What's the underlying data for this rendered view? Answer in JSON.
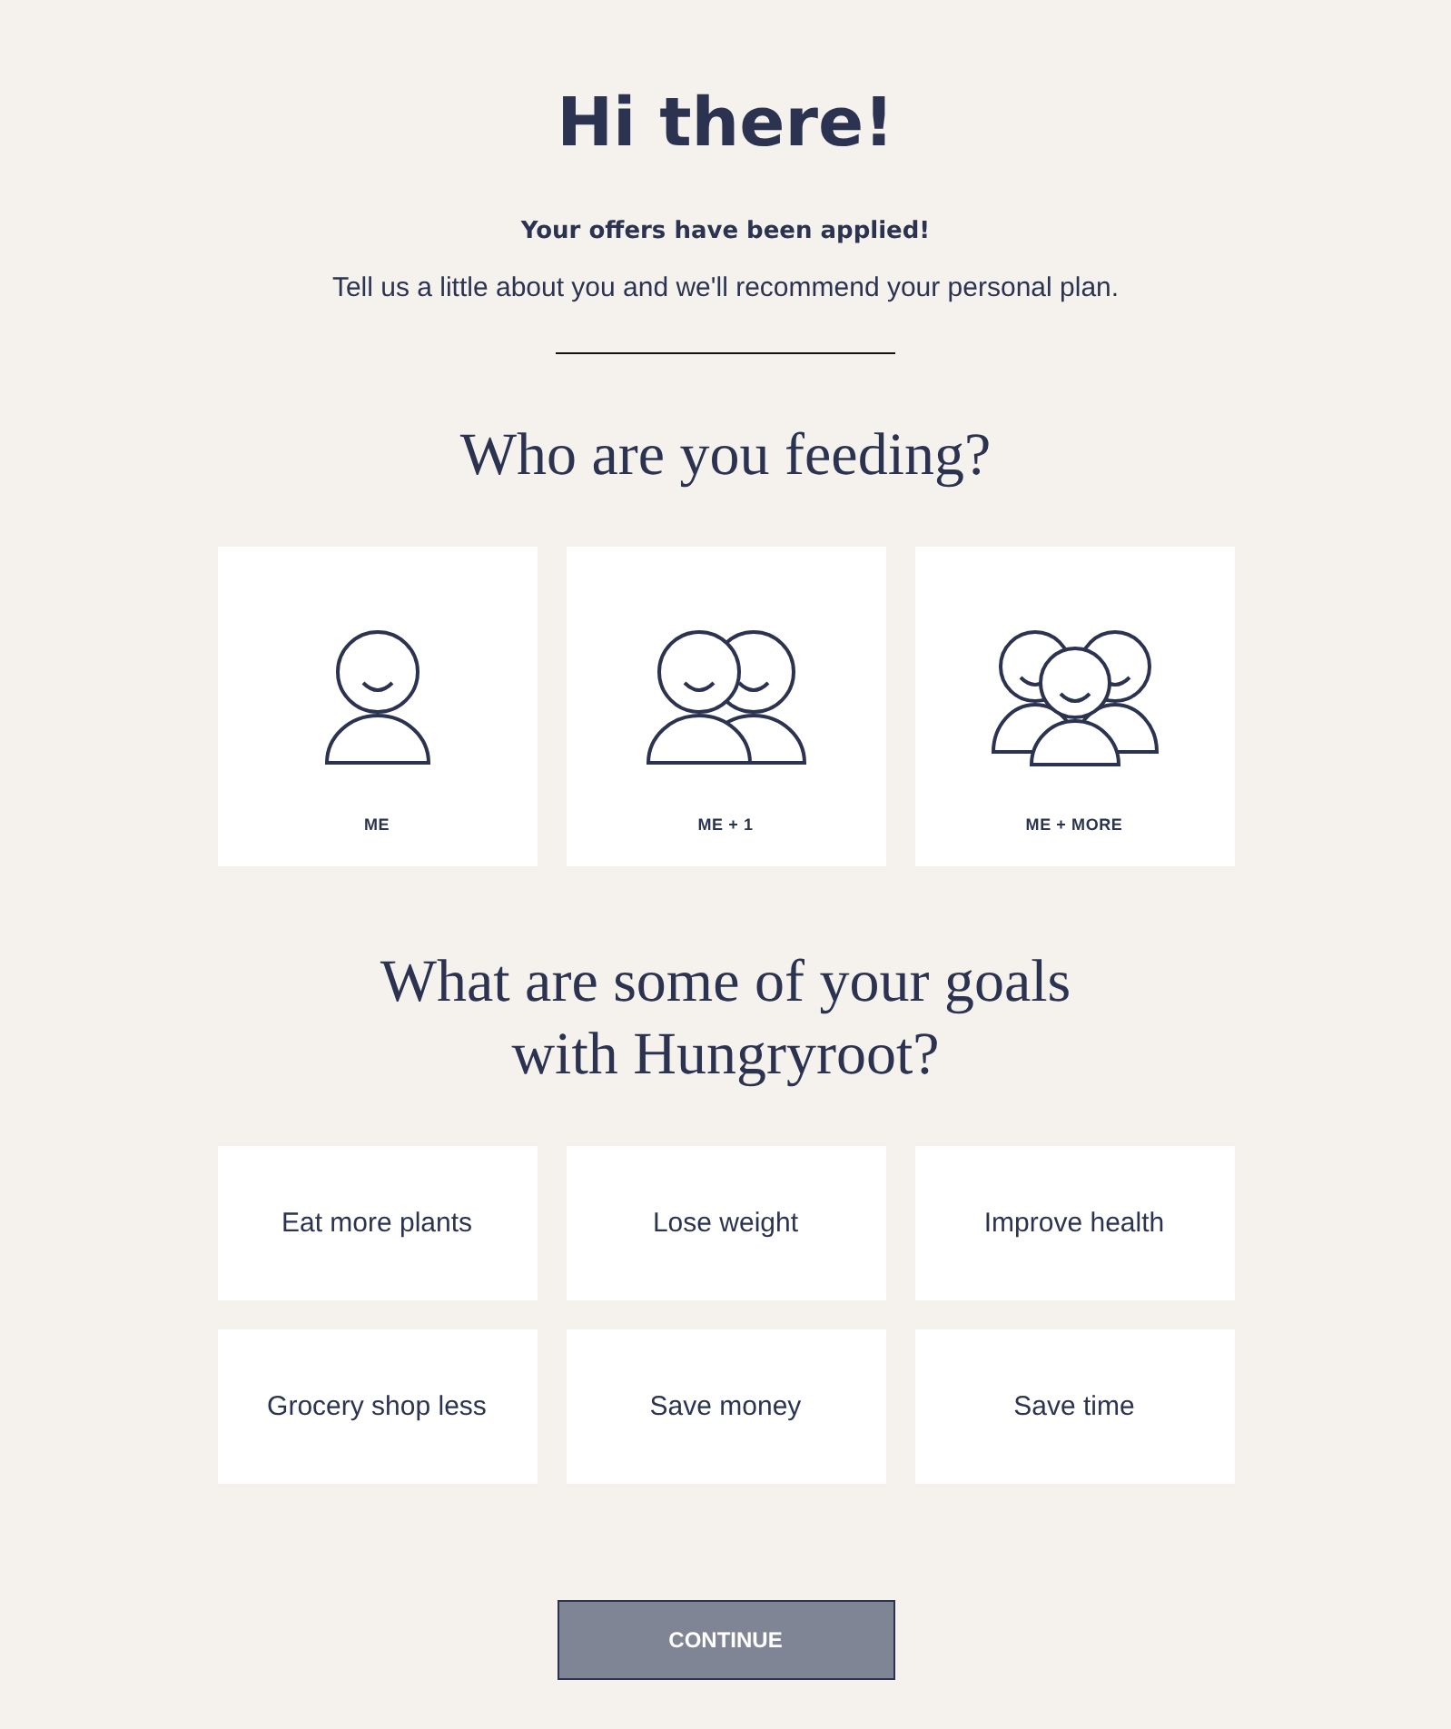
{
  "title": "Hi there!",
  "offer_notice": "Your offers have been applied!",
  "intro": "Tell us a little about you and we'll recommend your personal plan.",
  "household": {
    "heading": "Who are you feeding?",
    "options": [
      {
        "label": "ME",
        "kind": "one",
        "selected": false
      },
      {
        "label": "ME + 1",
        "kind": "two",
        "selected": false
      },
      {
        "label": "ME + MORE",
        "kind": "many",
        "selected": false
      }
    ]
  },
  "goals": {
    "heading_lines": [
      "What are some of your goals",
      "with Hungryroot?"
    ],
    "options": [
      {
        "label": "Eat more plants",
        "selected": false
      },
      {
        "label": "Lose weight",
        "selected": false
      },
      {
        "label": "Improve health",
        "selected": false
      },
      {
        "label": "Grocery shop less",
        "selected": false
      },
      {
        "label": "Save money",
        "selected": false
      },
      {
        "label": "Save time",
        "selected": false
      }
    ]
  },
  "continue_button": {
    "label": "CONTINUE",
    "disabled": true
  }
}
